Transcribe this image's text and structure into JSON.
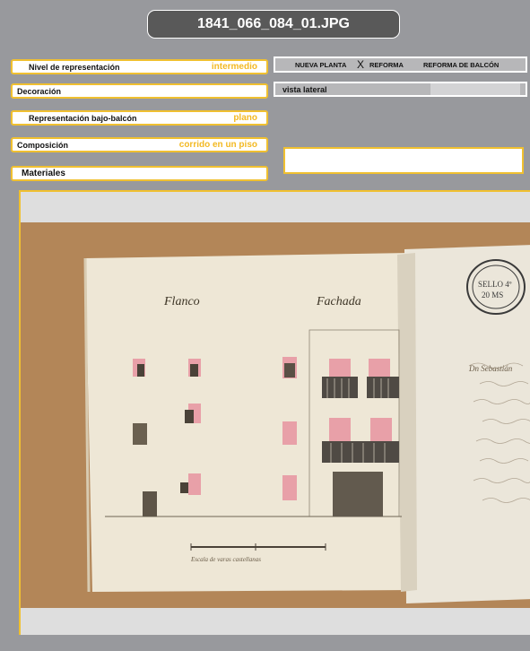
{
  "header": {
    "title": "1841_066_084_01.JPG"
  },
  "fields": {
    "nivel": {
      "label": "Nivel de representación",
      "value": "intermedio"
    },
    "decoracion": {
      "label": "Decoración"
    },
    "bajo_balcon": {
      "label": "Representación bajo-balcón",
      "value": "plano"
    },
    "composicion": {
      "label": "Composición",
      "value": "corrido en un piso"
    },
    "materiales": {
      "label": "Materiales"
    }
  },
  "reform": {
    "nueva_planta": "NUEVA PLANTA",
    "mark": "X",
    "reforma": "REFORMA",
    "reforma_balcon": "REFORMA DE BALCÓN"
  },
  "vista": {
    "label": "vista lateral"
  },
  "document": {
    "heading_left": "Flanco",
    "heading_right": "Fachada",
    "stamp_line1": "SELLO 4º",
    "stamp_line2": "20 MS",
    "scale_label": "Escala de varas castellanas",
    "text_fragment": "Dn Sebastián"
  },
  "colors": {
    "accent": "#f0c030",
    "value_text": "#f3b923",
    "background": "#98999d"
  }
}
